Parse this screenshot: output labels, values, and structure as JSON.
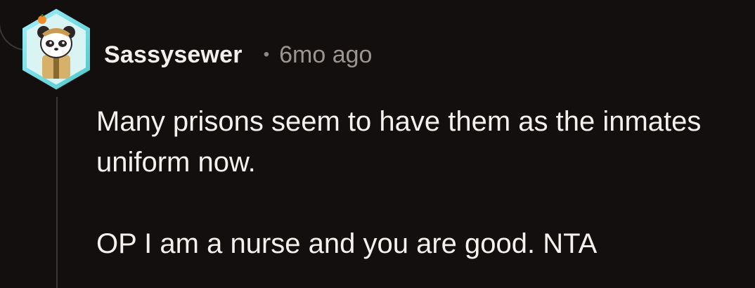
{
  "comment": {
    "username": "Sassysewer",
    "separator": "•",
    "timestamp": "6mo ago",
    "paragraphs": [
      "Many prisons seem to have them as the inmates uniform now.",
      "OP I am a nurse and you are good. NTA"
    ]
  },
  "colors": {
    "background": "#130f0e",
    "username": "#f2efec",
    "meta": "#9a9591",
    "body_text": "#f4f1ee",
    "thread_line": "#3a3633",
    "avatar_border": "#7fe0e6"
  },
  "icons": {
    "avatar": "panda-avatar-icon"
  }
}
